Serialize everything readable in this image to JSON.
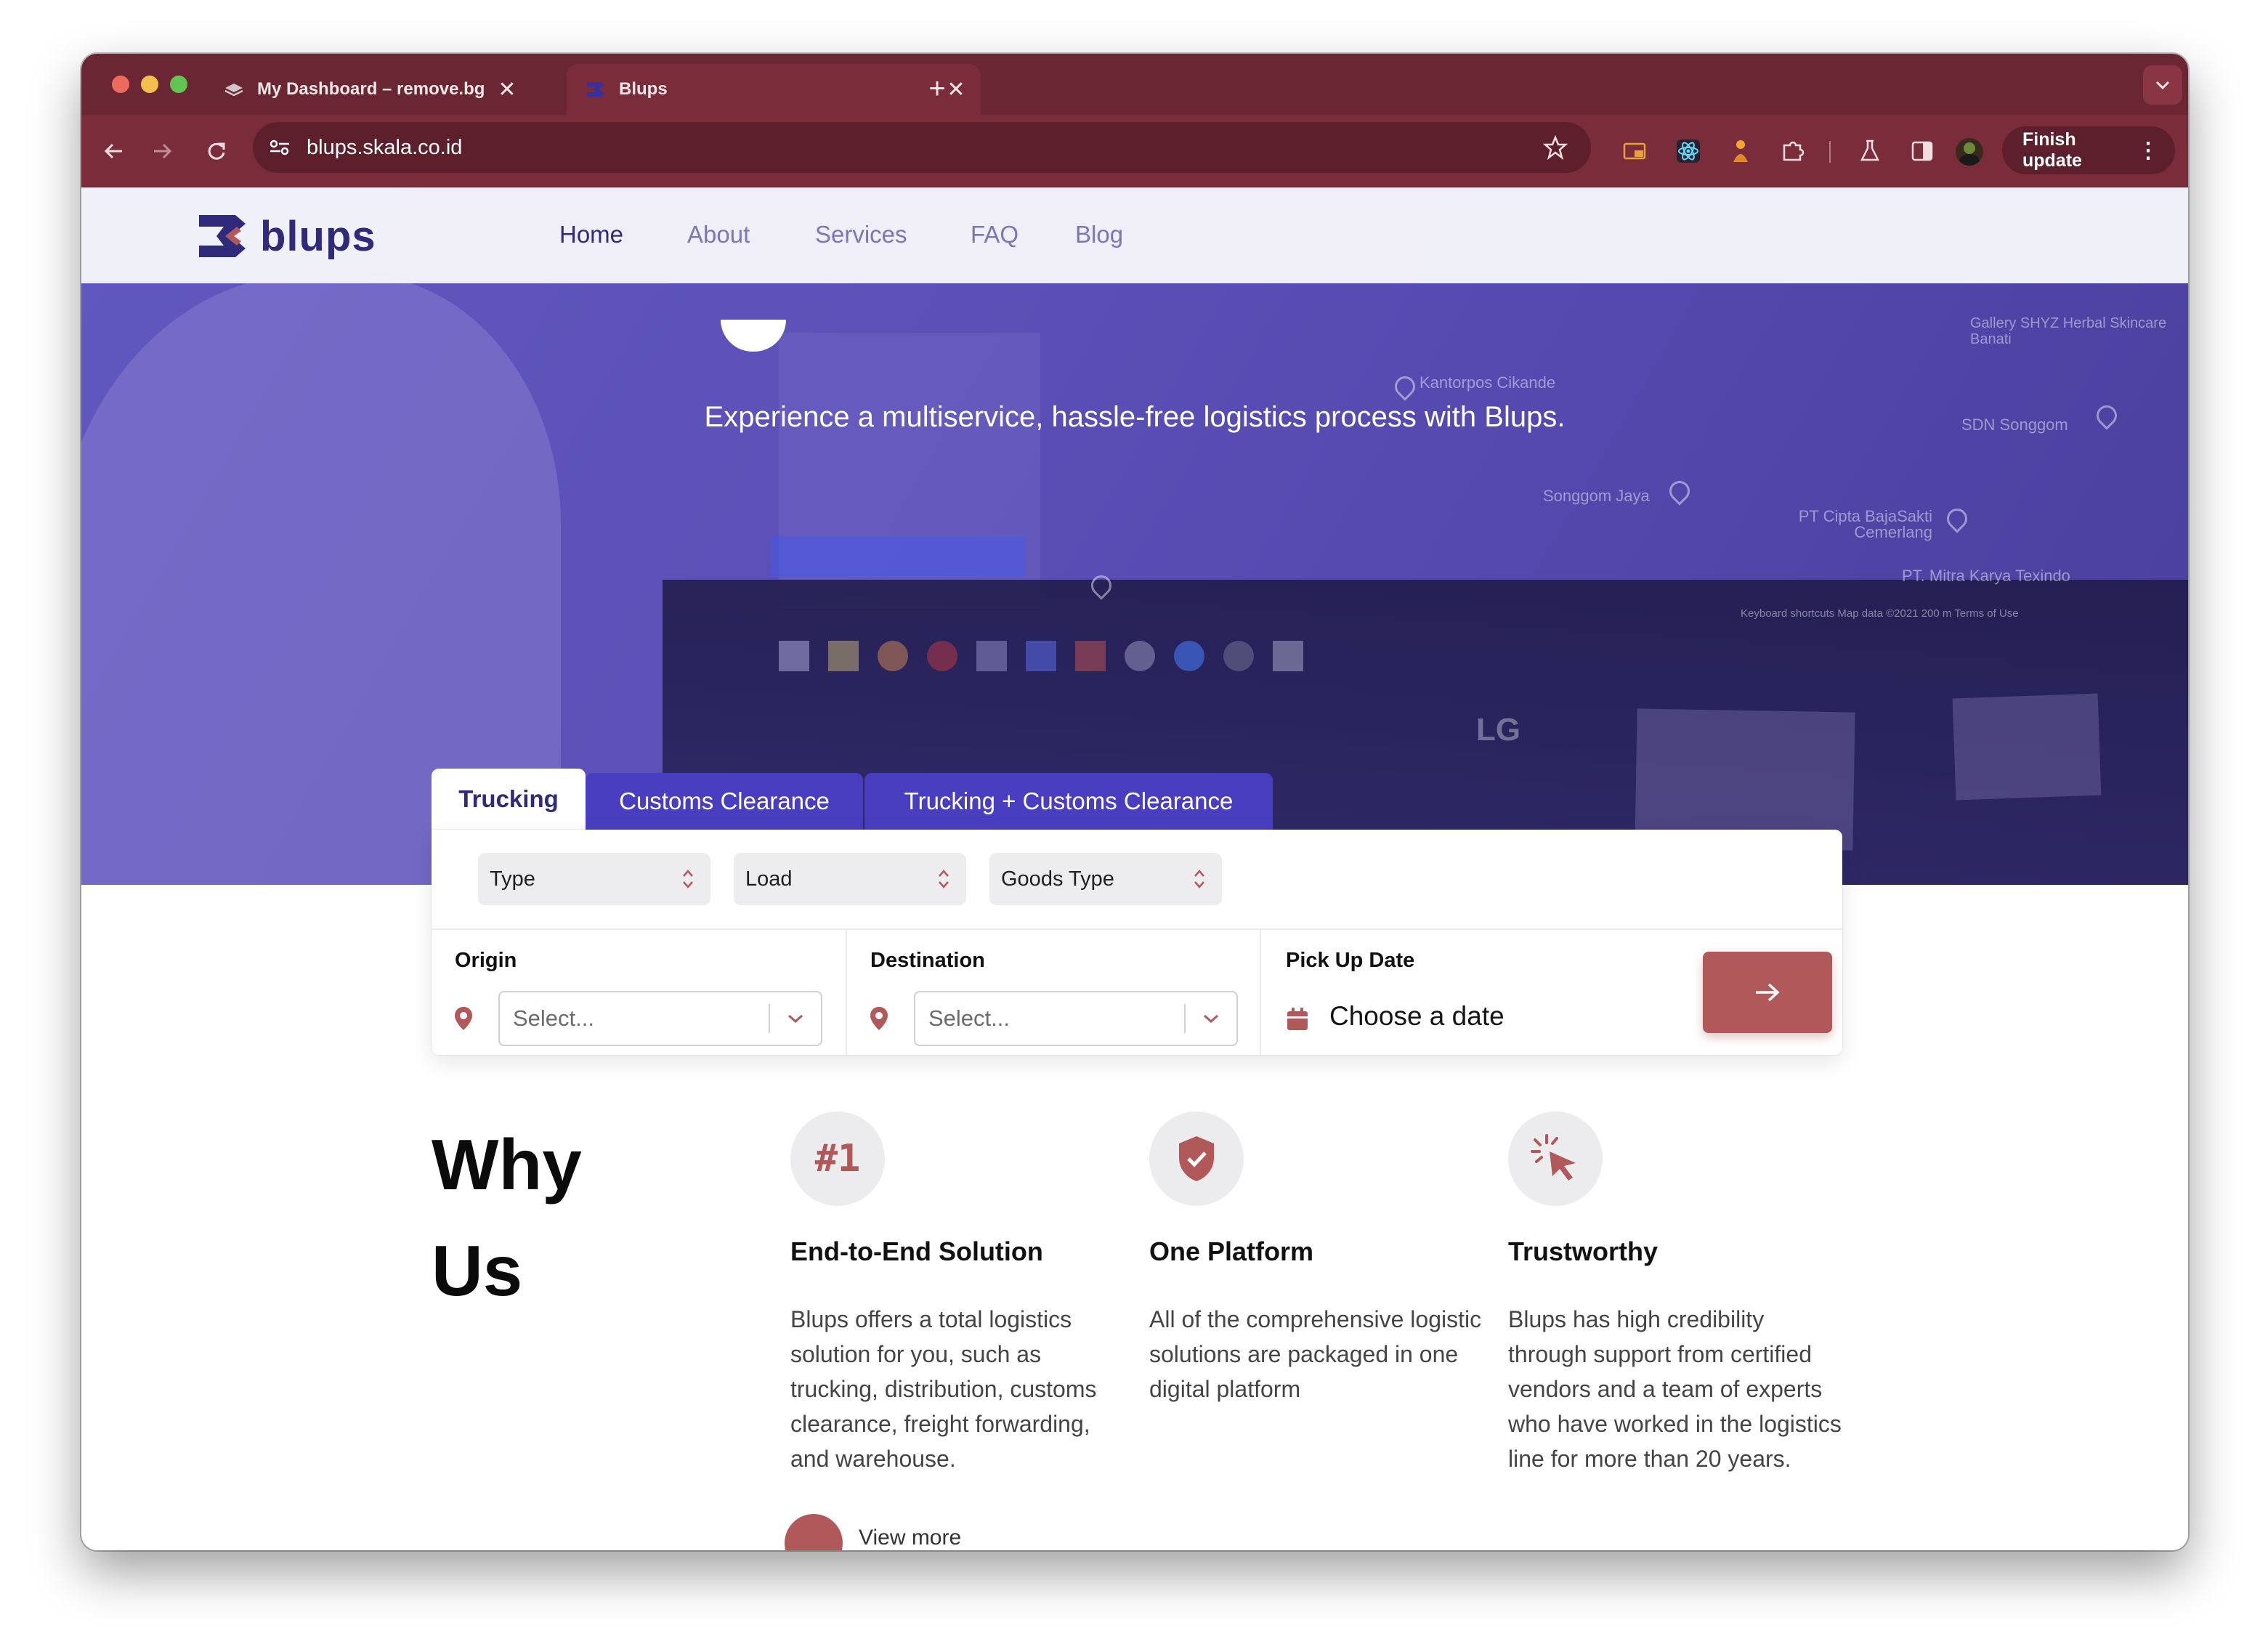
{
  "browser": {
    "tabs": [
      {
        "title": "My Dashboard – remove.bg",
        "active": false
      },
      {
        "title": "Blups",
        "active": true
      }
    ],
    "new_tab_symbol": "+",
    "close_symbol": "✕",
    "url": "blups.skala.co.id",
    "finish_update_label": "Finish update",
    "colors": {
      "frame": "#6a2632",
      "toolbar": "#7a2c3a",
      "omnibox": "#5c1f2b"
    }
  },
  "site": {
    "logo_text": "blups",
    "nav": [
      {
        "label": "Home",
        "active": true
      },
      {
        "label": "About",
        "active": false
      },
      {
        "label": "Services",
        "active": false
      },
      {
        "label": "FAQ",
        "active": false
      },
      {
        "label": "Blog",
        "active": false
      }
    ],
    "tagline": "Experience a multiservice, hassle-free logistics process with Blups.",
    "colors": {
      "brand": "#2f2a7a",
      "accent": "#b0585a",
      "hero": "#5b51b8"
    }
  },
  "hero_background_text": {
    "places": [
      "Kantorpos Cikande",
      "SDN Songgom",
      "Songgom Jaya",
      "PT Cipta BajaSakti Cemerlang",
      "PT. Mitra Karya Texindo",
      "Gallery SHYZ Herbal Skincare Banati"
    ],
    "map_footer": "Keyboard shortcuts   Map data ©2021   200 m   Terms of Use",
    "monitor_brand": "LG"
  },
  "booking": {
    "tabs": [
      {
        "label": "Trucking",
        "active": true
      },
      {
        "label": "Customs Clearance",
        "active": false
      },
      {
        "label": "Trucking + Customs Clearance",
        "active": false
      }
    ],
    "filters": [
      "Type",
      "Load",
      "Goods Type"
    ],
    "origin": {
      "label": "Origin",
      "placeholder": "Select..."
    },
    "destination": {
      "label": "Destination",
      "placeholder": "Select..."
    },
    "pickup": {
      "label": "Pick Up Date",
      "placeholder": "Choose a date"
    },
    "submit_icon": "arrow-right-icon"
  },
  "why_us": {
    "title_line1": "Why",
    "title_line2": "Us",
    "features": [
      {
        "icon": "#1",
        "title": "End-to-End Solution",
        "desc": "Blups offers a total logistics solution for you, such as trucking, distribution, customs clearance, freight forwarding, and warehouse."
      },
      {
        "icon": "shield-check-icon",
        "title": "One Platform",
        "desc": "All of the comprehensive logistic solutions are packaged in one digital platform"
      },
      {
        "icon": "cursor-click-icon",
        "title": "Trustworthy",
        "desc": "Blups has high credibility through support from certified vendors and a team of experts who have worked in the logistics line for more than 20 years."
      }
    ],
    "view_more": "View more"
  }
}
